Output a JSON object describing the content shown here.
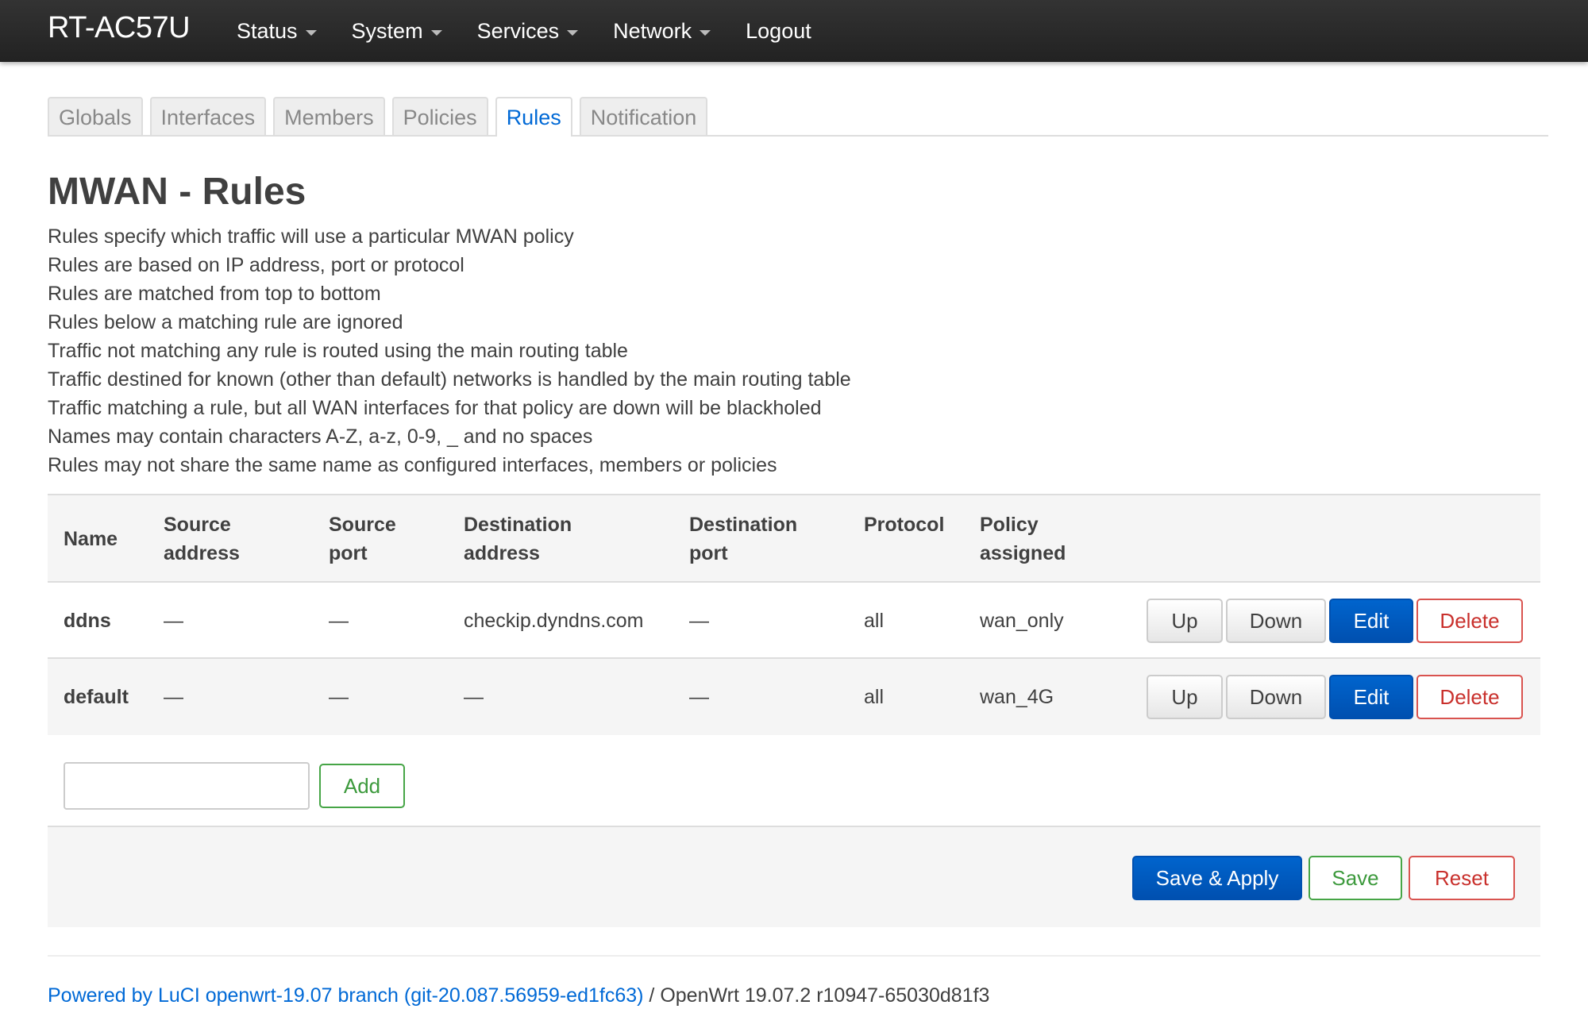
{
  "navbar": {
    "brand": "RT-AC57U",
    "menu": [
      {
        "label": "Status",
        "dropdown": true
      },
      {
        "label": "System",
        "dropdown": true
      },
      {
        "label": "Services",
        "dropdown": true
      },
      {
        "label": "Network",
        "dropdown": true
      },
      {
        "label": "Logout",
        "dropdown": false
      }
    ]
  },
  "tabs": [
    {
      "label": "Globals",
      "active": false
    },
    {
      "label": "Interfaces",
      "active": false
    },
    {
      "label": "Members",
      "active": false
    },
    {
      "label": "Policies",
      "active": false
    },
    {
      "label": "Rules",
      "active": true
    },
    {
      "label": "Notification",
      "active": false
    }
  ],
  "page": {
    "title": "MWAN - Rules",
    "description": [
      "Rules specify which traffic will use a particular MWAN policy",
      "Rules are based on IP address, port or protocol",
      "Rules are matched from top to bottom",
      "Rules below a matching rule are ignored",
      "Traffic not matching any rule is routed using the main routing table",
      "Traffic destined for known (other than default) networks is handled by the main routing table",
      "Traffic matching a rule, but all WAN interfaces for that policy are down will be blackholed",
      "Names may contain characters A-Z, a-z, 0-9, _ and no spaces",
      "Rules may not share the same name as configured interfaces, members or policies"
    ]
  },
  "table": {
    "headers": {
      "name": "Name",
      "source_address": [
        "Source",
        "address"
      ],
      "source_port": [
        "Source",
        "port"
      ],
      "destination_address": [
        "Destination",
        "address"
      ],
      "destination_port": [
        "Destination",
        "port"
      ],
      "protocol": "Protocol",
      "policy_assigned": [
        "Policy",
        "assigned"
      ]
    },
    "rows": [
      {
        "name": "ddns",
        "source_address": "—",
        "source_port": "—",
        "destination_address": "checkip.dyndns.com",
        "destination_port": "—",
        "protocol": "all",
        "policy_assigned": "wan_only"
      },
      {
        "name": "default",
        "source_address": "—",
        "source_port": "—",
        "destination_address": "—",
        "destination_port": "—",
        "protocol": "all",
        "policy_assigned": "wan_4G"
      }
    ],
    "row_buttons": {
      "up": "Up",
      "down": "Down",
      "edit": "Edit",
      "delete": "Delete"
    }
  },
  "add": {
    "input_value": "",
    "button_label": "Add"
  },
  "actions": {
    "save_apply": "Save & Apply",
    "save": "Save",
    "reset": "Reset"
  },
  "footer": {
    "link_text": "Powered by LuCI openwrt-19.07 branch (git-20.087.56959-ed1fc63)",
    "version_text": " / OpenWrt 19.07.2 r10947-65030d81f3"
  },
  "colors": {
    "navbar": "#222222",
    "primary": "#0064cd",
    "danger": "#d9534f",
    "success": "#46a546",
    "link": "#0069d6"
  }
}
